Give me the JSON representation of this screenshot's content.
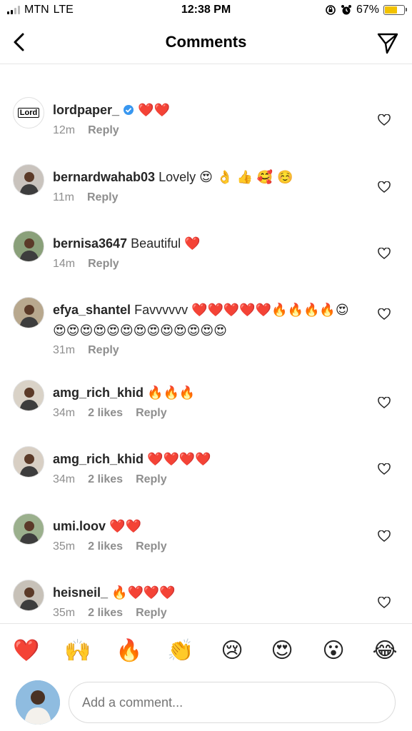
{
  "status_bar": {
    "carrier": "MTN",
    "network": "LTE",
    "time": "12:38 PM",
    "battery_text": "67%",
    "battery_level": 0.67,
    "battery_color": "#f2c200"
  },
  "header": {
    "title": "Comments",
    "back_icon": "chevron-left-icon",
    "action_icon": "paper-plane-icon"
  },
  "comments": [
    {
      "username": "lordpaper_",
      "verified": true,
      "text": "",
      "emoji": "❤️❤️",
      "time": "12m",
      "likes": "",
      "reply": "Reply"
    },
    {
      "username": "bernardwahab03",
      "verified": false,
      "text": "Lovely",
      "emoji": "😍 👌 👍 🥰 ☺️",
      "time": "11m",
      "likes": "",
      "reply": "Reply"
    },
    {
      "username": "bernisa3647",
      "verified": false,
      "text": "Beautiful",
      "emoji": "❤️",
      "time": "14m",
      "likes": "",
      "reply": "Reply"
    },
    {
      "username": "efya_shantel",
      "verified": false,
      "text": "Favvvvvv",
      "emoji": "❤️❤️❤️❤️❤️🔥🔥🔥🔥😍😍😍😍😍😍😍😍😍😍😍😍😍😍",
      "time": "31m",
      "likes": "",
      "reply": "Reply"
    },
    {
      "username": "amg_rich_khid",
      "verified": false,
      "text": "",
      "emoji": "🔥🔥🔥",
      "time": "34m",
      "likes": "2 likes",
      "reply": "Reply"
    },
    {
      "username": "amg_rich_khid",
      "verified": false,
      "text": "",
      "emoji": "❤️❤️❤️❤️",
      "time": "34m",
      "likes": "2 likes",
      "reply": "Reply"
    },
    {
      "username": "umi.loov",
      "verified": false,
      "text": "",
      "emoji": "❤️❤️",
      "time": "35m",
      "likes": "2 likes",
      "reply": "Reply"
    },
    {
      "username": "heisneil_",
      "verified": false,
      "text": "",
      "emoji": "🔥❤️❤️❤️",
      "time": "35m",
      "likes": "2 likes",
      "reply": "Reply"
    }
  ],
  "lordpaper_avatar_text": "Lord",
  "reactions": [
    "❤️",
    "🙌",
    "🔥",
    "👏",
    "😢",
    "😍",
    "😮",
    "😂"
  ],
  "compose": {
    "placeholder": "Add a comment..."
  },
  "colors": {
    "text": "#262626",
    "muted": "#8e8e8e",
    "divider": "#e6e6e6",
    "verified": "#3897f0",
    "heart_red": "#e0245e"
  }
}
